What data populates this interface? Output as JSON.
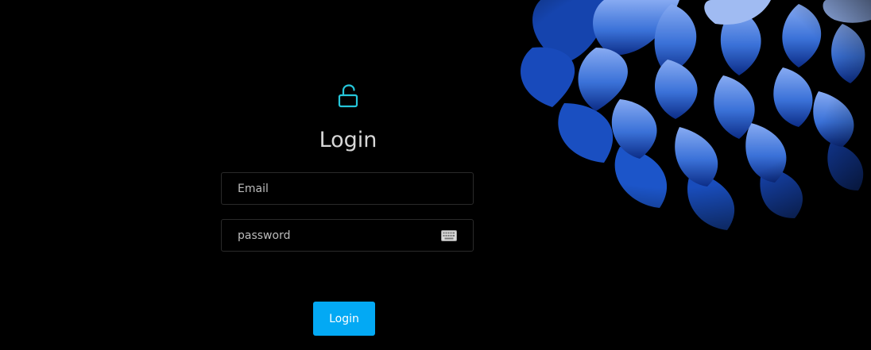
{
  "login": {
    "title": "Login",
    "email_placeholder": "Email",
    "password_placeholder": "password",
    "button_label": "Login"
  },
  "icons": {
    "lock": "lock-open-icon",
    "keyboard": "keyboard-icon"
  },
  "colors": {
    "background": "#000000",
    "accent_teal": "#26c6da",
    "button": "#03a9f4",
    "flower_blue": "#2f6ee3"
  }
}
